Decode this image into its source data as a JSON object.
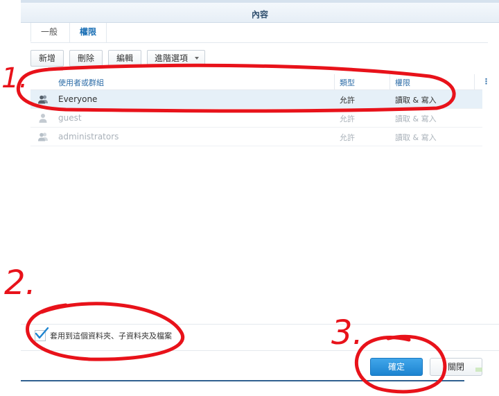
{
  "dialog": {
    "title": "內容",
    "tabs": [
      {
        "label": "一般",
        "active": false
      },
      {
        "label": "權限",
        "active": true
      }
    ],
    "toolbar": {
      "add": "新增",
      "delete": "刪除",
      "edit": "編輯",
      "advanced": "進階選項"
    },
    "grid": {
      "columns": [
        "使用者或群組",
        "類型",
        "權限"
      ],
      "rows": [
        {
          "name": "Everyone",
          "type": "允許",
          "perm": "讀取 & 寫入",
          "selected": true,
          "dimmed": false
        },
        {
          "name": "guest",
          "type": "允許",
          "perm": "讀取 & 寫入",
          "selected": false,
          "dimmed": true
        },
        {
          "name": "administrators",
          "type": "允許",
          "perm": "讀取 & 寫入",
          "selected": false,
          "dimmed": true
        }
      ]
    },
    "apply_checkbox": {
      "label": "套用到這個資料夾、子資料夾及檔案",
      "checked": true
    },
    "ok": "確定",
    "close": "關閉"
  },
  "annotations": [
    "1.",
    "2.",
    "3."
  ],
  "colors": {
    "accent": "#1a6fb5",
    "ok_button": "#2a92dc",
    "selected_row": "#e6f0f8",
    "annotation": "#e8121a"
  }
}
